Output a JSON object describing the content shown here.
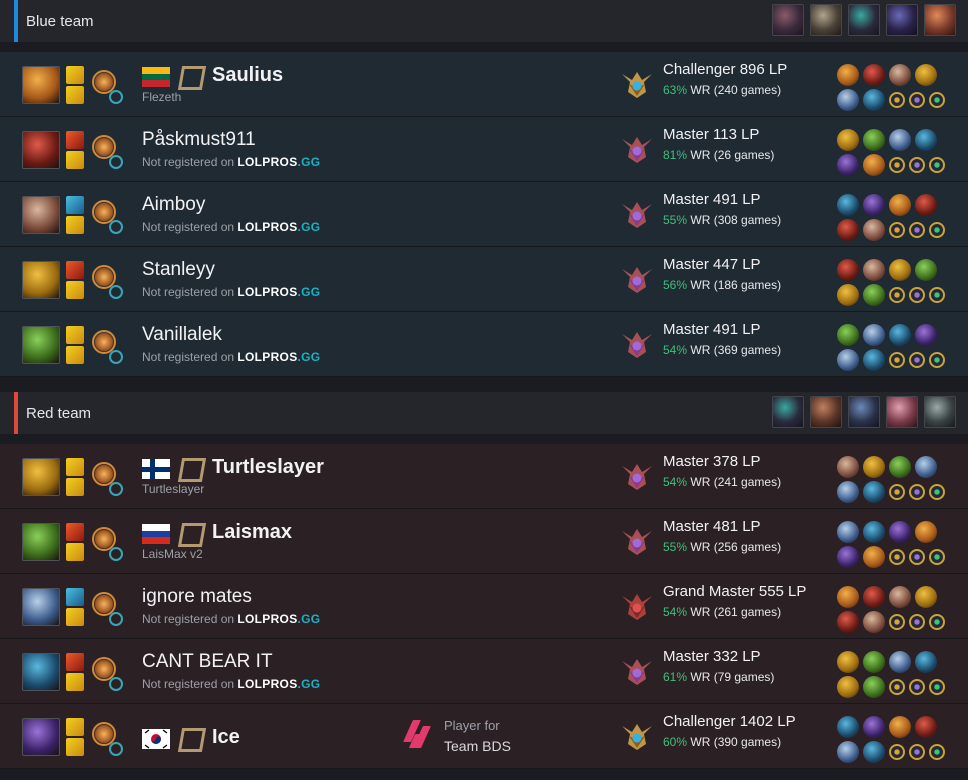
{
  "colors": {
    "blue_stripe": "#1f8ad6",
    "red_stripe": "#e0483b",
    "win_rate": "#3fc07a",
    "lolpros_gg": "#19b2c6"
  },
  "not_registered_prefix": "Not registered on ",
  "lolpros_brand": "LOLPROS",
  "lolpros_gg": ".GG",
  "blue_team": {
    "title": "Blue team",
    "bans": [
      "ban-1",
      "ban-2",
      "ban-3",
      "ban-4",
      "ban-5"
    ],
    "players": [
      {
        "name": "Saulius",
        "pro": true,
        "flag": "lithuania",
        "subtitle": "Flezeth",
        "rank": "Challenger 896 LP",
        "wr": "63%",
        "games": "WR (240 games)",
        "emblem": "challenger"
      },
      {
        "name": "Påskmust911",
        "pro": false,
        "rank": "Master 113 LP",
        "wr": "81%",
        "games": "WR (26 games)",
        "emblem": "master"
      },
      {
        "name": "Aimboy",
        "pro": false,
        "rank": "Master 491 LP",
        "wr": "55%",
        "games": "WR (308 games)",
        "emblem": "master"
      },
      {
        "name": "Stanleyy",
        "pro": false,
        "rank": "Master 447 LP",
        "wr": "56%",
        "games": "WR (186 games)",
        "emblem": "master"
      },
      {
        "name": "Vanillalek",
        "pro": false,
        "rank": "Master 491 LP",
        "wr": "54%",
        "games": "WR (369 games)",
        "emblem": "master"
      }
    ]
  },
  "red_team": {
    "title": "Red team",
    "bans": [
      "ban-1",
      "ban-2",
      "ban-3",
      "ban-4",
      "ban-5"
    ],
    "players": [
      {
        "name": "Turtleslayer",
        "pro": true,
        "flag": "finland",
        "subtitle": "Turtleslayer",
        "rank": "Master 378 LP",
        "wr": "54%",
        "games": "WR (241 games)",
        "emblem": "master"
      },
      {
        "name": "Laismax",
        "pro": true,
        "flag": "russia",
        "subtitle": "LaisMax v2",
        "rank": "Master 481 LP",
        "wr": "55%",
        "games": "WR (256 games)",
        "emblem": "master"
      },
      {
        "name": "ignore mates",
        "pro": false,
        "rank": "Grand Master 555 LP",
        "wr": "54%",
        "games": "WR (261 games)",
        "emblem": "grandmaster"
      },
      {
        "name": "CANT BEAR IT",
        "pro": false,
        "rank": "Master 332 LP",
        "wr": "61%",
        "games": "WR (79 games)",
        "emblem": "master"
      },
      {
        "name": "Ice",
        "pro": true,
        "flag": "south-korea",
        "subtitle": "",
        "team_label": "Player for",
        "team_name": "Team BDS",
        "rank": "Challenger 1402 LP",
        "wr": "60%",
        "games": "WR (390 games)",
        "emblem": "challenger"
      }
    ]
  }
}
